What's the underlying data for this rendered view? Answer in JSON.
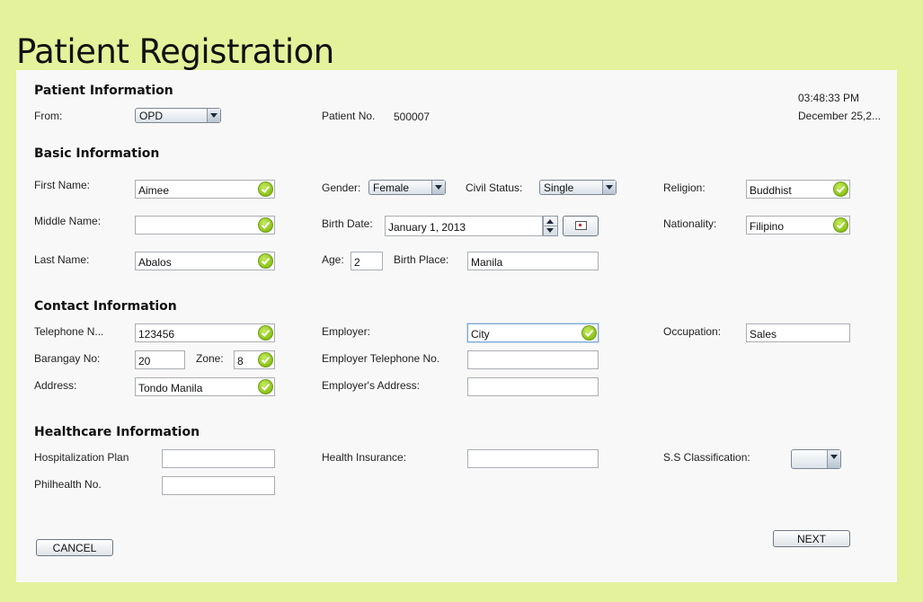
{
  "title": "Patient Registration",
  "clock": {
    "time": "03:48:33 PM",
    "date": "December 25,2..."
  },
  "patient_info": {
    "heading": "Patient Information",
    "from_label": "From:",
    "from_value": "OPD",
    "patient_no_label": "Patient No.",
    "patient_no_value": "500007"
  },
  "basic_info": {
    "heading": "Basic Information",
    "first_name_label": "First Name:",
    "first_name_value": "Aimee",
    "middle_name_label": "Middle Name:",
    "middle_name_value": "",
    "last_name_label": "Last Name:",
    "last_name_value": "Abalos",
    "gender_label": "Gender:",
    "gender_value": "Female",
    "civil_status_label": "Civil Status:",
    "civil_status_value": "Single",
    "birth_date_label": "Birth Date:",
    "birth_date_value": "January 1, 2013",
    "age_label": "Age:",
    "age_value": "2",
    "birth_place_label": "Birth Place:",
    "birth_place_value": "Manila",
    "religion_label": "Religion:",
    "religion_value": "Buddhist",
    "nationality_label": "Nationality:",
    "nationality_value": "Filipino"
  },
  "contact_info": {
    "heading": "Contact Information",
    "telephone_label": "Telephone N...",
    "telephone_value": "123456",
    "barangay_label": "Barangay No:",
    "barangay_value": "20",
    "zone_label": "Zone:",
    "zone_value": "8",
    "address_label": "Address:",
    "address_value": "Tondo Manila",
    "employer_label": "Employer:",
    "employer_value": "City",
    "employer_tel_label": "Employer Telephone No.",
    "employer_tel_value": "",
    "employer_address_label": "Employer's Address:",
    "employer_address_value": "",
    "occupation_label": "Occupation:",
    "occupation_value": "Sales"
  },
  "healthcare_info": {
    "heading": "Healthcare Information",
    "hospitalization_label": "Hospitalization Plan",
    "hospitalization_value": "",
    "philhealth_label": "Philhealth No.",
    "philhealth_value": "",
    "health_insurance_label": "Health Insurance:",
    "health_insurance_value": "",
    "ss_classification_label": "S.S Classification:",
    "ss_classification_value": ""
  },
  "buttons": {
    "cancel": "CANCEL",
    "next": "NEXT"
  },
  "icons": {
    "valid": "check-circle-icon",
    "calendar": "calendar-icon"
  },
  "colors": {
    "background": "#e3f29b",
    "panel": "#f8f8f8",
    "valid_green": "#8cc219"
  }
}
